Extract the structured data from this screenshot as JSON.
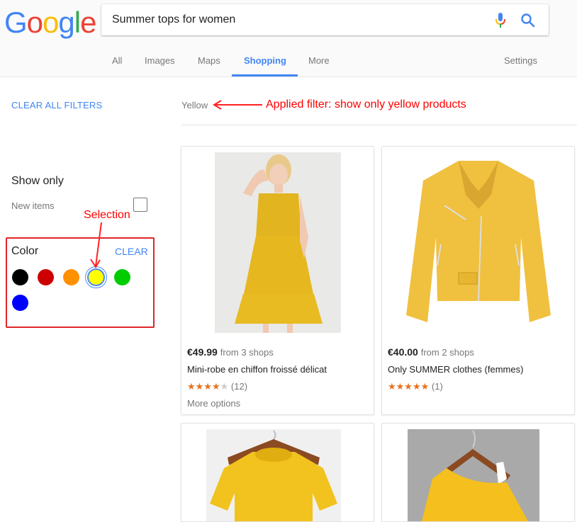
{
  "header": {
    "logo_letters": [
      {
        "ch": "G",
        "color": "#4285f4"
      },
      {
        "ch": "o",
        "color": "#ea4335"
      },
      {
        "ch": "o",
        "color": "#fbbc05"
      },
      {
        "ch": "g",
        "color": "#4285f4"
      },
      {
        "ch": "l",
        "color": "#34a853"
      },
      {
        "ch": "e",
        "color": "#ea4335"
      }
    ],
    "search_value": "Summer tops for women",
    "tabs": [
      {
        "label": "All"
      },
      {
        "label": "Images"
      },
      {
        "label": "Maps"
      },
      {
        "label": "Shopping",
        "active": true
      },
      {
        "label": "More"
      }
    ],
    "settings_label": "Settings"
  },
  "sidebar": {
    "clear_all_label": "CLEAR ALL FILTERS",
    "show_only_title": "Show only",
    "new_items_label": "New items",
    "new_items_checked": false,
    "color_title": "Color",
    "color_clear_label": "CLEAR",
    "colors": [
      {
        "name": "black",
        "hex": "#000000"
      },
      {
        "name": "red",
        "hex": "#cc0000"
      },
      {
        "name": "orange",
        "hex": "#ff9000"
      },
      {
        "name": "yellow",
        "hex": "#ffff00",
        "selected": true
      },
      {
        "name": "green",
        "hex": "#00cc00"
      },
      {
        "name": "blue",
        "hex": "#0000ff"
      }
    ]
  },
  "annotations": {
    "selection": "Selection",
    "applied_filter": "Applied filter: show only yellow products",
    "color": "#ff0000"
  },
  "results": {
    "applied_filter_chip": "Yellow",
    "products": [
      {
        "image": "yellow chiffon dress",
        "price": "€49.99",
        "shops": "from 3 shops",
        "title": "Mini-robe en chiffon froissé délicat",
        "rating": 4,
        "reviews": "(12)",
        "more_options": "More options"
      },
      {
        "image": "yellow biker jacket",
        "price": "€40.00",
        "shops": "from 2 shops",
        "title": "Only SUMMER clothes (femmes)",
        "rating": 5,
        "reviews": "(1)"
      },
      {
        "image": "yellow t-shirt on hanger"
      },
      {
        "image": "yellow one-shoulder top on hanger"
      }
    ]
  }
}
